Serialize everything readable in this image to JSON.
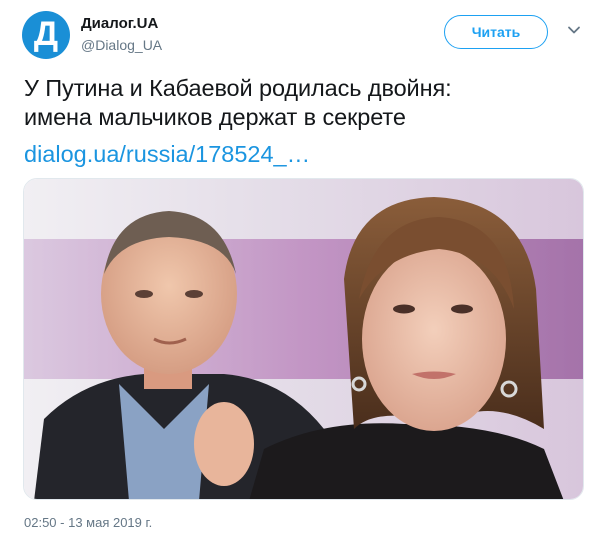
{
  "account": {
    "avatar_letter": "Д",
    "name": "Диалог.UA",
    "handle": "@Dialog_UA"
  },
  "actions": {
    "follow_label": "Читать",
    "menu_icon": "chevron-down-icon"
  },
  "tweet": {
    "line1": "У Путина и Кабаевой родилась двойня:",
    "line2": "имена мальчиков держат в секрете",
    "link": "dialog.ua/russia/178524_…",
    "timestamp": "02:50 - 13 мая 2019 г."
  },
  "colors": {
    "avatar_bg": "#1a8fd6",
    "accent": "#1da1f2",
    "link": "#1b95e0",
    "text": "#14171a",
    "muted": "#657786"
  }
}
